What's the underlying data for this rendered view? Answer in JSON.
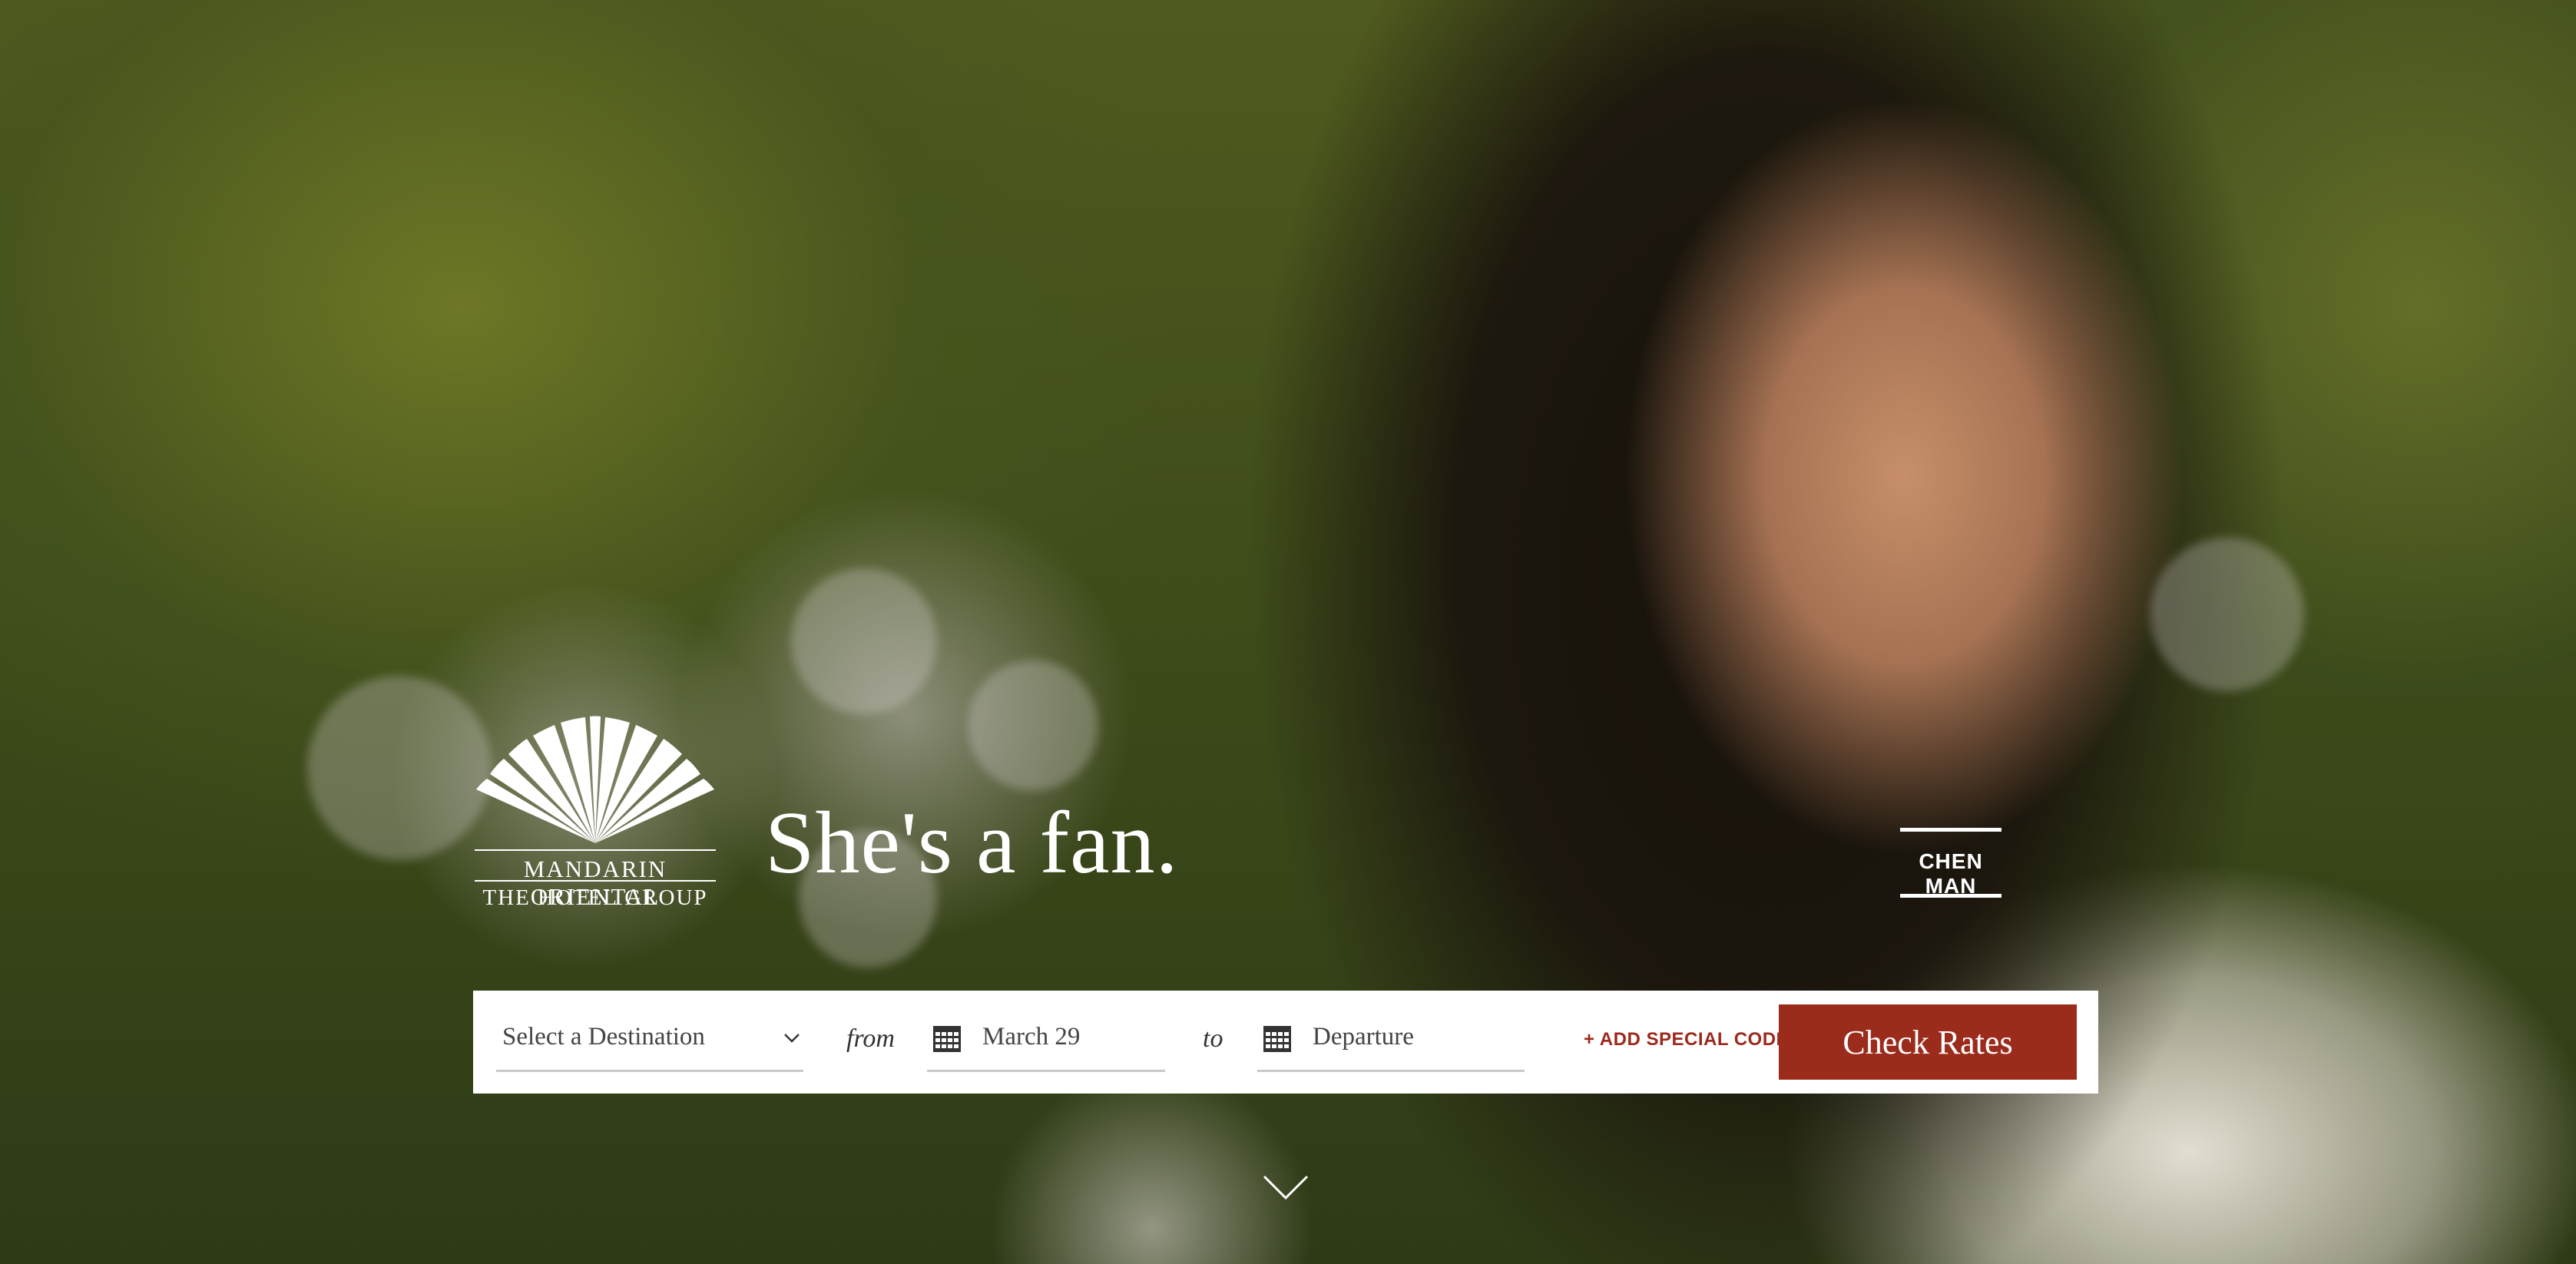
{
  "brand": {
    "name_line1": "MANDARIN ORIENTAL",
    "name_line2": "THE HOTEL GROUP",
    "logo_icon": "fan-icon"
  },
  "hero": {
    "headline": "She's a fan.",
    "credit": "CHEN MAN"
  },
  "booking": {
    "destination_placeholder": "Select a Destination",
    "from_label": "from",
    "arrival_value": "March 29",
    "to_label": "to",
    "departure_placeholder": "Departure",
    "special_code_label": "+ ADD SPECIAL CODE",
    "submit_label": "Check Rates"
  },
  "colors": {
    "accent": "#9b2c1c",
    "text_white": "#ffffff"
  },
  "icons": {
    "destination_dropdown": "chevron-down-icon",
    "date": "calendar-icon",
    "scroll": "chevron-down-icon"
  }
}
